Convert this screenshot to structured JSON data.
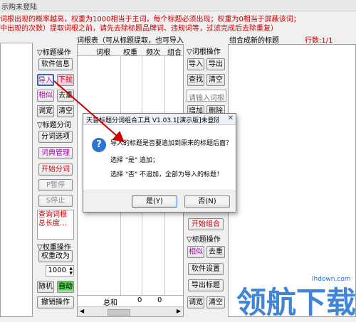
{
  "titlebar": {
    "text": "示购未登陆"
  },
  "info": {
    "line1": "词根出现的概率越高，权重为1000相当于主词，每个标题必须出现；权重为0相当于屏蔽该词；",
    "line2": "中出现的次数）提取词根之前，请先去除标题品牌词、违规词等，过滤完成后去除重复）"
  },
  "left_col": {
    "title_ops_label": "▽标题操作",
    "soft_info": "软件信息",
    "import": "导入",
    "dropdown": "下拉",
    "similar": "相似",
    "dedupe": "去重",
    "adjust_width": "调宽",
    "clear": "清空",
    "seg_label": "▽标题分词",
    "seg_options": "分词选项",
    "dict_manage": "词典管理",
    "start_seg": "开始分词",
    "pause": "P暂停",
    "stop": "S停止",
    "hint": "查询词根总长度…",
    "weight_label": "▽权重操作",
    "weight_change": "权重改为",
    "weight_value": "1000",
    "random": "随机",
    "auto": "自动",
    "undo": "撤销操作"
  },
  "root_table": {
    "header": "词根表（可从标题提取，也可导入）",
    "columns": [
      "词根",
      "权重",
      "频次",
      "组合"
    ],
    "footer_label": "总和",
    "footer_values": [
      "0",
      "0"
    ]
  },
  "right_col": {
    "root_ops_label": "▽词根操作",
    "import": "导入",
    "export": "导出",
    "find": "查找",
    "clear": "清空",
    "input_placeholder": "请输入词根",
    "add": "增加",
    "delete": "删除",
    "start_combine": "开始组合",
    "title_ops_label": "▽标题操作",
    "similar": "相似",
    "dedupe": "去重",
    "soft_settings": "软件设置",
    "export_titles": "导出标题",
    "adjust_width": "调宽",
    "clear2": "清空"
  },
  "combo_header": {
    "label": "组合成新的标题",
    "rows": "行数:1/1"
  },
  "dialog": {
    "title": "天音标题分词组合工具 V1.03.1[演示版]未登陆",
    "close_symbol": "✕",
    "question": "导入的标题是否要追加到原来的标题后面？",
    "line_yes": "选择 \"是\" 追加；",
    "line_no": "选择 \"否\" 不追加，全部为导入的标题！",
    "yes": "是(Y)",
    "no": "否(N)"
  },
  "watermark": {
    "big": "领航下载",
    "small": "lhdown.com"
  },
  "colors": {
    "accent_red": "#d00000",
    "pink_button": "#f7c8e2",
    "selected_text": "#c00000",
    "purple_text": "#a000a0"
  }
}
